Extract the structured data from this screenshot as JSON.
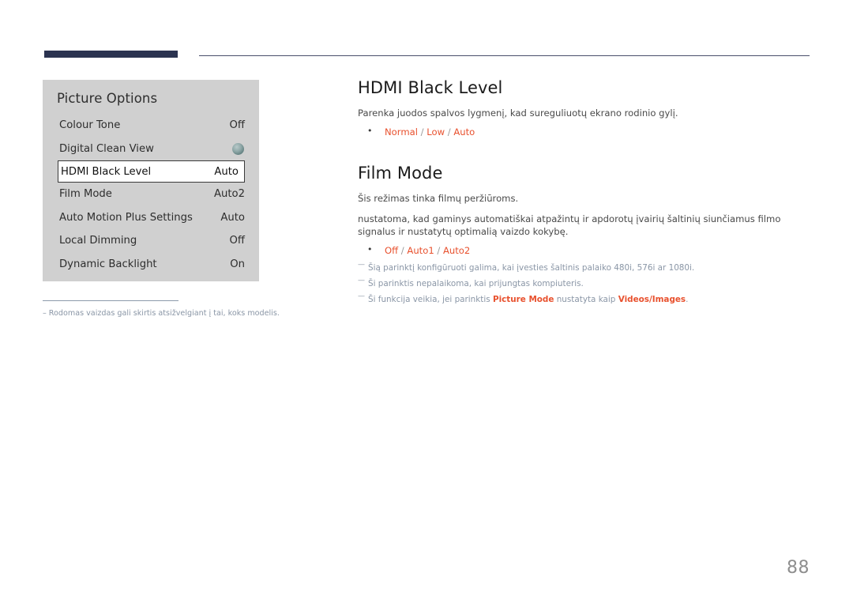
{
  "header": {
    "accent_color": "#2b3350",
    "rule_color": "#4a4f6b"
  },
  "osd_panel": {
    "title": "Picture Options",
    "background": "#d0d0d0",
    "rows": [
      {
        "label": "Colour Tone",
        "value": "Off",
        "type": "text",
        "selected": false
      },
      {
        "label": "Digital Clean View",
        "value": "",
        "type": "dot",
        "selected": false
      },
      {
        "label": "HDMI Black Level",
        "value": "Auto",
        "type": "text",
        "selected": true
      },
      {
        "label": "Film Mode",
        "value": "Auto2",
        "type": "text",
        "selected": false
      },
      {
        "label": "Auto Motion Plus Settings",
        "value": "Auto",
        "type": "text",
        "selected": false
      },
      {
        "label": "Local Dimming",
        "value": "Off",
        "type": "text",
        "selected": false
      },
      {
        "label": "Dynamic Backlight",
        "value": "On",
        "type": "text",
        "selected": false
      }
    ]
  },
  "panel_footnote": {
    "dash": "–",
    "text": "Rodomas vaizdas gali skirtis atsižvelgiant į tai, koks modelis."
  },
  "content": {
    "section1": {
      "heading": "HDMI Black Level",
      "description": "Parenka juodos spalvos lygmenį, kad sureguliuotų ekrano rodinio gylį.",
      "options": [
        "Normal",
        "Low",
        "Auto"
      ],
      "option_separator": "/"
    },
    "section2": {
      "heading": "Film Mode",
      "description1": "Šis režimas tinka filmų peržiūroms.",
      "description2": "nustatoma, kad gaminys automatiškai atpažintų ir apdorotų įvairių šaltinių siunčiamus filmo signalus ir nustatytų optimalią vaizdo kokybę.",
      "options": [
        "Off",
        "Auto1",
        "Auto2"
      ],
      "option_separator": "/",
      "notes": [
        {
          "prefix": "Šią parinktį konfigūruoti galima, kai įvesties šaltinis palaiko 480i, 576i ar 1080i.",
          "hl1": "",
          "mid": "",
          "hl2": "",
          "suffix": ""
        },
        {
          "prefix": "Ši parinktis nepalaikoma, kai prijungtas kompiuteris.",
          "hl1": "",
          "mid": "",
          "hl2": "",
          "suffix": ""
        },
        {
          "prefix": "Ši funkcija veikia, jei parinktis ",
          "hl1": "Picture Mode",
          "mid": " nustatyta kaip ",
          "hl2": "Videos/Images",
          "suffix": "."
        }
      ]
    }
  },
  "page_number": "88",
  "colors": {
    "accent_orange": "#e8512e",
    "note_gray_blue": "#8a96a6",
    "heading": "#1b1b1b",
    "body": "#4a4a4a"
  }
}
